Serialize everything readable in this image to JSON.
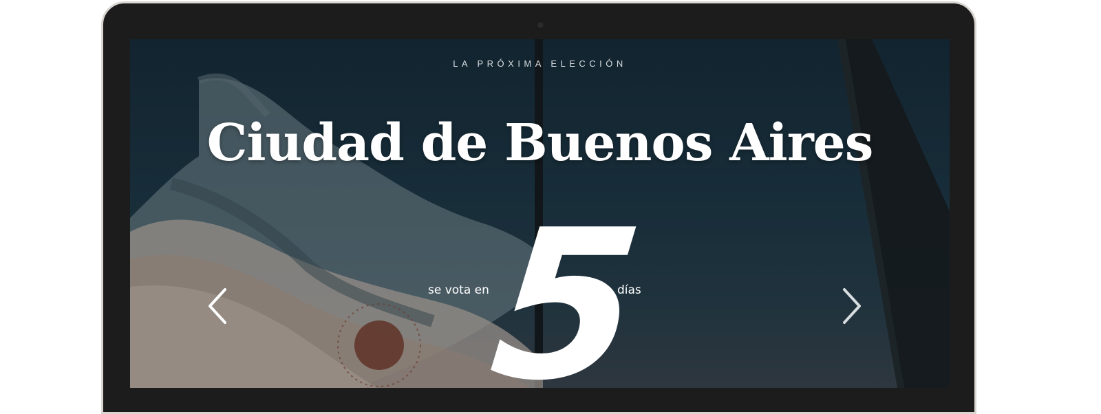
{
  "hero": {
    "eyebrow": "LA PRÓXIMA ELECCIÓN",
    "city": "Ciudad de Buenos Aires",
    "prefix": "se vota en",
    "days": "5",
    "suffix": "días"
  },
  "nav": {
    "prev_icon": "chevron-left-icon",
    "next_icon": "chevron-right-icon"
  },
  "colors": {
    "text": "#ffffff",
    "frame": "#1c1c1c",
    "sky": "#1b3340"
  }
}
